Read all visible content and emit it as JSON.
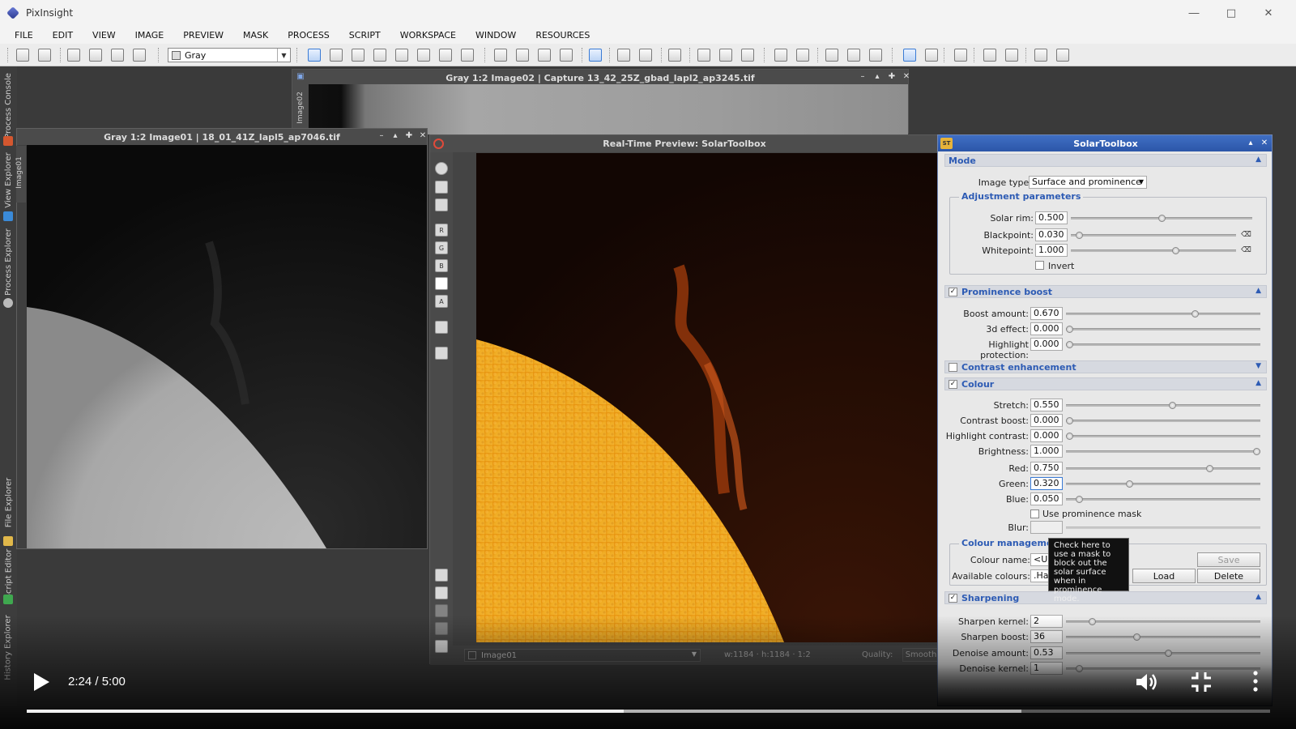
{
  "app": {
    "title": "PixInsight"
  },
  "menu": [
    "FILE",
    "EDIT",
    "VIEW",
    "IMAGE",
    "PREVIEW",
    "MASK",
    "PROCESS",
    "SCRIPT",
    "WORKSPACE",
    "WINDOW",
    "RESOURCES"
  ],
  "toolbar": {
    "color_mode": "Gray"
  },
  "left_dock": {
    "tabs": [
      "Process Console",
      "View Explorer",
      "Process Explorer",
      "File Explorer",
      "Script Editor",
      "History Explorer"
    ]
  },
  "image_window_2": {
    "title": "Gray 1:2 Image02 | Capture 13_42_25Z_gbad_lapl2_ap3245.tif",
    "side_label": "Image02"
  },
  "image_window_1": {
    "title": "Gray 1:2 Image01 | 18_01_41Z_lapl5_ap7046.tif",
    "side_label": "Image01"
  },
  "preview": {
    "title": "Real-Time Preview: SolarToolbox",
    "view_select": "Image01",
    "dimensions": "w:1184 · h:1184 · 1:2",
    "quality_label": "Quality:",
    "quality_value": "Smooth",
    "tool_letters": [
      "R",
      "G",
      "B",
      "",
      "A"
    ]
  },
  "solar_toolbox": {
    "title": "SolarToolbox",
    "icon_text": "ST",
    "mode": {
      "label": "Mode",
      "image_type_label": "Image type:",
      "image_type_value": "Surface and prominence",
      "adjustment_title": "Adjustment parameters",
      "solar_rim": {
        "label": "Solar rim:",
        "value": "0.500",
        "level": 0.5
      },
      "blackpoint": {
        "label": "Blackpoint:",
        "value": "0.030",
        "level": 0.03
      },
      "whitepoint": {
        "label": "Whitepoint:",
        "value": "1.000",
        "level": 0.64
      },
      "invert_label": "Invert"
    },
    "prominence_boost": {
      "label": "Prominence boost",
      "boost_amount": {
        "label": "Boost amount:",
        "value": "0.670",
        "level": 0.67
      },
      "effect_3d": {
        "label": "3d effect:",
        "value": "0.000",
        "level": 0
      },
      "highlight_protection": {
        "label": "Highlight protection:",
        "value": "0.000",
        "level": 0
      }
    },
    "contrast_enhancement": {
      "label": "Contrast enhancement"
    },
    "colour": {
      "label": "Colour",
      "stretch": {
        "label": "Stretch:",
        "value": "0.550",
        "level": 0.55
      },
      "contrast_boost": {
        "label": "Contrast boost:",
        "value": "0.000",
        "level": 0
      },
      "highlight_contrast": {
        "label": "Highlight contrast:",
        "value": "0.000",
        "level": 0
      },
      "brightness": {
        "label": "Brightness:",
        "value": "1.000",
        "level": 1
      },
      "red": {
        "label": "Red:",
        "value": "0.750",
        "level": 0.75
      },
      "green": {
        "label": "Green:",
        "value": "0.320",
        "level": 0.32
      },
      "blue": {
        "label": "Blue:",
        "value": "0.050",
        "level": 0.05
      },
      "use_prominence_mask": "Use prominence mask",
      "blur_label": "Blur:",
      "management_title": "Colour management",
      "colour_name_label": "Colour name:",
      "colour_name_value": "<U",
      "available_colours_label": "Available colours:",
      "available_colours_value": ".Ha",
      "save": "Save",
      "load": "Load",
      "delete": "Delete",
      "tooltip": "Check here to use a mask to block out the solar surface when in prominence mode."
    },
    "sharpening": {
      "label": "Sharpening",
      "sharpen_kernel": {
        "label": "Sharpen kernel:",
        "value": "2",
        "level": 0.12
      },
      "sharpen_boost": {
        "label": "Sharpen boost:",
        "value": "36",
        "level": 0.36
      },
      "denoise_amount": {
        "label": "Denoise amount:",
        "value": "0.53",
        "level": 0.53
      },
      "denoise_kernel": {
        "label": "Denoise kernel:",
        "value": "1",
        "level": 0.05
      }
    }
  },
  "video": {
    "time": "2:24 / 5:00",
    "progress": 0.48,
    "buffered": 0.8
  }
}
